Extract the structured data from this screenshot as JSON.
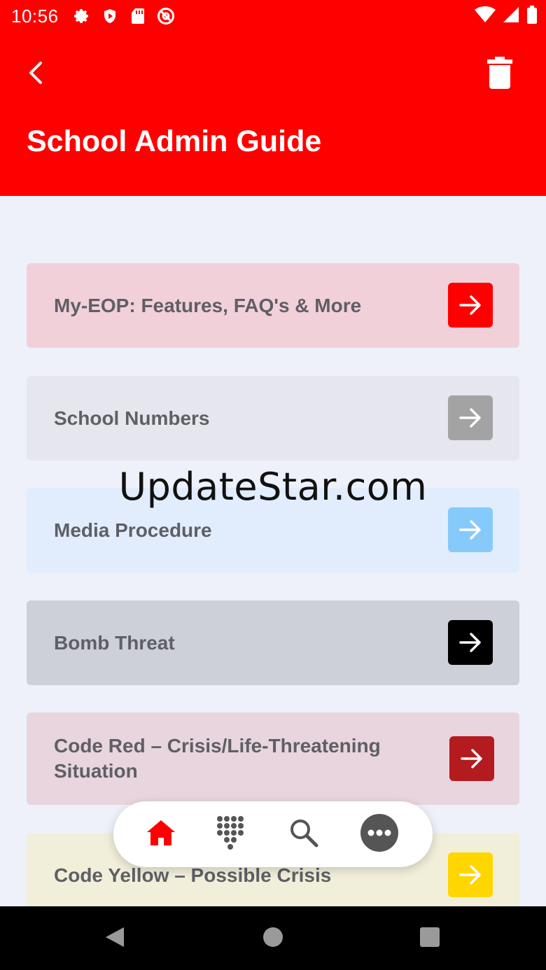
{
  "status_bar": {
    "time": "10:56",
    "left_icons": [
      "gear-icon",
      "shield-play-icon",
      "sd-card-icon",
      "at-sign-icon"
    ],
    "right_icons": [
      "wifi-icon",
      "signal-icon",
      "battery-icon"
    ]
  },
  "header": {
    "title": "School Admin Guide",
    "background": "#FF0000",
    "back_icon": "chevron-left-icon",
    "delete_icon": "trash-icon"
  },
  "cards": [
    {
      "label": "My-EOP: Features, FAQ's & More",
      "background": "#F2D0D9",
      "arrow_color": "#FF0000"
    },
    {
      "label": "School Numbers",
      "background": "#E6E7EE",
      "arrow_color": "#A3A3A3"
    },
    {
      "label": "Media Procedure",
      "background": "#E1EDFC",
      "arrow_color": "#86CAFB"
    },
    {
      "label": "Bomb Threat",
      "background": "#CDD0D9",
      "arrow_color": "#000000"
    },
    {
      "label": "Code Red – Crisis/Life-Threatening Situation",
      "background": "#E8D5DD",
      "arrow_color": "#B31B1E"
    },
    {
      "label": "Code Yellow – Possible Crisis",
      "background": "#F1EFDA",
      "arrow_color": "#FFD600"
    }
  ],
  "watermark": "UpdateStar.com",
  "bottom_nav": {
    "items": [
      "home-icon",
      "dialpad-icon",
      "search-icon",
      "more-icon"
    ],
    "active_color": "#FF0000"
  },
  "system_nav": [
    "back-triangle-icon",
    "home-circle-icon",
    "recents-square-icon"
  ]
}
